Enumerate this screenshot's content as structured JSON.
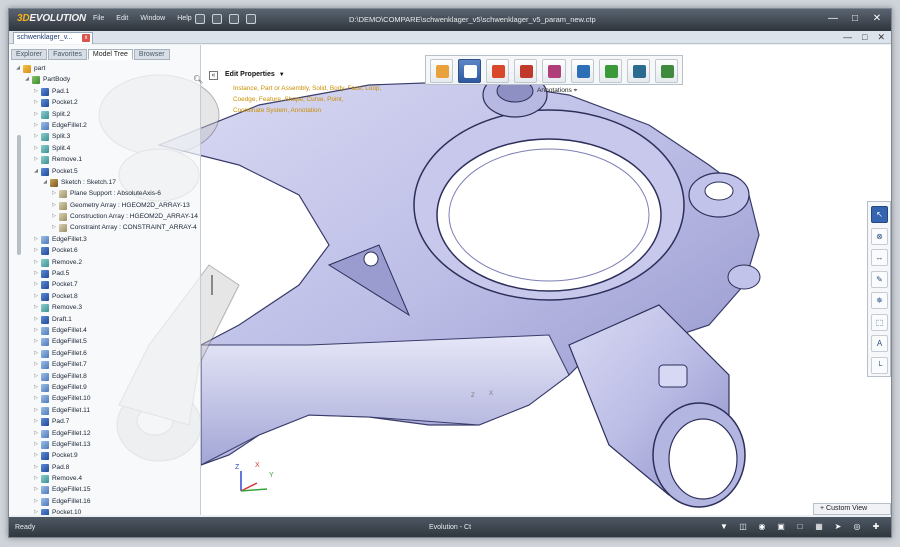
{
  "app": {
    "logo_prefix": "3D",
    "logo_name": "EVOLUTION",
    "title": "D:\\DEMO\\COMPARE\\schwenklager_v5\\schwenklager_v5_param_new.ctp",
    "menu": [
      "File",
      "Edit",
      "Window",
      "Help"
    ],
    "quick_access": [
      "undo-icon",
      "open-folder-icon",
      "save-icon",
      "print-icon"
    ],
    "window_buttons": {
      "minimize": "—",
      "maximize": "□",
      "close": "✕"
    }
  },
  "doc_tabs": [
    {
      "label": "schwenklager_v...",
      "close": "x"
    }
  ],
  "doc_buttons": {
    "minimize": "—",
    "restore": "□",
    "close": "✕"
  },
  "panel": {
    "tabs": [
      "Explorer",
      "Favorites",
      "Model Tree",
      "Browser"
    ],
    "active_tab": "Model Tree",
    "tree": [
      {
        "label": "part",
        "depth": 0,
        "icon": "part",
        "expanded": true
      },
      {
        "label": "PartBody",
        "depth": 1,
        "icon": "body",
        "expanded": true
      },
      {
        "label": "Pad.1",
        "depth": 2,
        "icon": "feat"
      },
      {
        "label": "Pocket.2",
        "depth": 2,
        "icon": "feat"
      },
      {
        "label": "Split.2",
        "depth": 2,
        "icon": "split"
      },
      {
        "label": "EdgeFillet.2",
        "depth": 2,
        "icon": "fill"
      },
      {
        "label": "Split.3",
        "depth": 2,
        "icon": "split"
      },
      {
        "label": "Split.4",
        "depth": 2,
        "icon": "split"
      },
      {
        "label": "Remove.1",
        "depth": 2,
        "icon": "split"
      },
      {
        "label": "Pocket.5",
        "depth": 2,
        "icon": "feat",
        "expanded": true
      },
      {
        "label": "Sketch : Sketch.17",
        "depth": 3,
        "icon": "sketch",
        "expanded": true
      },
      {
        "label": "Plane Support : AbsoluteAxis-6",
        "depth": 4,
        "icon": "sub"
      },
      {
        "label": "Geometry Array : HGEOM2D_ARRAY-13",
        "depth": 4,
        "icon": "sub"
      },
      {
        "label": "Construction Array : HGEOM2D_ARRAY-14",
        "depth": 4,
        "icon": "sub"
      },
      {
        "label": "Constraint Array : CONSTRAINT_ARRAY-4",
        "depth": 4,
        "icon": "sub"
      },
      {
        "label": "EdgeFillet.3",
        "depth": 2,
        "icon": "fill"
      },
      {
        "label": "Pocket.6",
        "depth": 2,
        "icon": "feat"
      },
      {
        "label": "Remove.2",
        "depth": 2,
        "icon": "split"
      },
      {
        "label": "Pad.5",
        "depth": 2,
        "icon": "feat"
      },
      {
        "label": "Pocket.7",
        "depth": 2,
        "icon": "feat"
      },
      {
        "label": "Pocket.8",
        "depth": 2,
        "icon": "feat"
      },
      {
        "label": "Remove.3",
        "depth": 2,
        "icon": "split"
      },
      {
        "label": "Draft.1",
        "depth": 2,
        "icon": "feat"
      },
      {
        "label": "EdgeFillet.4",
        "depth": 2,
        "icon": "fill"
      },
      {
        "label": "EdgeFillet.5",
        "depth": 2,
        "icon": "fill"
      },
      {
        "label": "EdgeFillet.6",
        "depth": 2,
        "icon": "fill"
      },
      {
        "label": "EdgeFillet.7",
        "depth": 2,
        "icon": "fill"
      },
      {
        "label": "EdgeFillet.8",
        "depth": 2,
        "icon": "fill"
      },
      {
        "label": "EdgeFillet.9",
        "depth": 2,
        "icon": "fill"
      },
      {
        "label": "EdgeFillet.10",
        "depth": 2,
        "icon": "fill"
      },
      {
        "label": "EdgeFillet.11",
        "depth": 2,
        "icon": "fill"
      },
      {
        "label": "Pad.7",
        "depth": 2,
        "icon": "feat"
      },
      {
        "label": "EdgeFillet.12",
        "depth": 2,
        "icon": "fill"
      },
      {
        "label": "EdgeFillet.13",
        "depth": 2,
        "icon": "fill"
      },
      {
        "label": "Pocket.9",
        "depth": 2,
        "icon": "feat"
      },
      {
        "label": "Pad.8",
        "depth": 2,
        "icon": "feat"
      },
      {
        "label": "Remove.4",
        "depth": 2,
        "icon": "split"
      },
      {
        "label": "EdgeFillet.15",
        "depth": 2,
        "icon": "fill"
      },
      {
        "label": "EdgeFillet.16",
        "depth": 2,
        "icon": "fill"
      },
      {
        "label": "Pocket.10",
        "depth": 2,
        "icon": "feat"
      }
    ]
  },
  "edit_properties": {
    "title": "Edit Properties",
    "hint_line1": "Instance, Part or Assembly, Solid, Body, Face, Loop,",
    "hint_line2": "Coedge, Feature, Shape, Curve, Point,",
    "hint_line3": "Coordinate System, Annotation"
  },
  "toolbar": {
    "buttons": [
      {
        "icon": "measure-icon",
        "color": "#e9a23b",
        "selected": false
      },
      {
        "icon": "edit-properties-icon",
        "color": "#ffffff",
        "selected": true
      },
      {
        "icon": "tools-icon",
        "color": "#d9482b",
        "selected": false
      },
      {
        "icon": "section-icon",
        "color": "#c0392b",
        "selected": false
      },
      {
        "icon": "compare-icon",
        "color": "#b03e7a",
        "selected": false
      },
      {
        "icon": "export-icon",
        "color": "#2c6fb7",
        "selected": false
      },
      {
        "icon": "fit-icon",
        "color": "#3a9a3a",
        "selected": false
      },
      {
        "icon": "select-box-icon",
        "color": "#2a6b8f",
        "selected": false
      },
      {
        "icon": "briefcase-icon",
        "color": "#3f8a3f",
        "selected": false
      }
    ],
    "annotations_label": "Annotations"
  },
  "right_toolbar": [
    "select-arrow-icon",
    "cancel-icon",
    "distance-icon",
    "text-note-icon",
    "axis-icon",
    "box-icon",
    "label-icon",
    "coordinate-icon"
  ],
  "triad": {
    "z": "Z",
    "x": "X",
    "y": "Y"
  },
  "custom_view": "Custom View",
  "status": {
    "left": "Ready",
    "center": "Evolution - Ct",
    "icons": [
      "filter-icon",
      "display-icon",
      "eye-icon",
      "cube-icon",
      "view-cube-icon",
      "render-icon",
      "arrow-icon",
      "globe-icon",
      "crosshair-icon"
    ]
  }
}
